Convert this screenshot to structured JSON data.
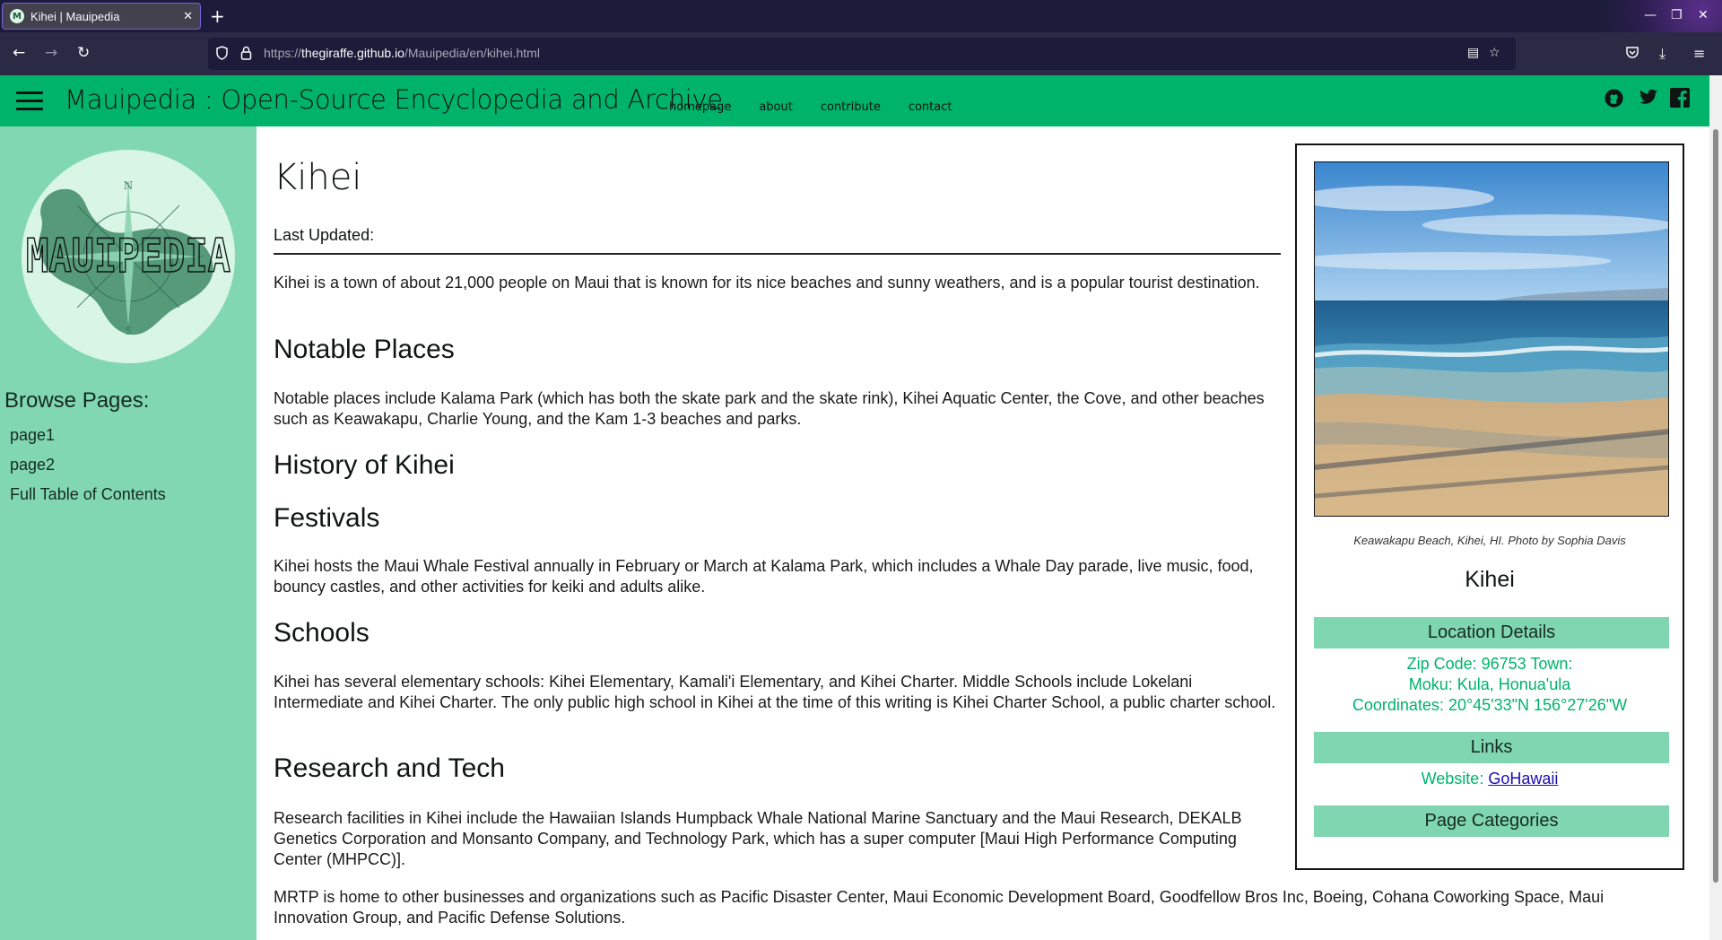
{
  "browser": {
    "tab_title": "Kihei | Mauipedia",
    "favicon_letter": "M",
    "url_prefix": "https://",
    "url_host": "thegiraffe.github.io",
    "url_path": "/Mauipedia/en/kihei.html"
  },
  "header": {
    "title": "Mauipedia : Open-Source Encyclopedia and Archive",
    "nav": [
      "homepage",
      "about",
      "contribute",
      "contact"
    ]
  },
  "sidebar": {
    "logo_text": "MAUIPEDIA",
    "compass_n": "N",
    "compass_s": "S",
    "browse_title": "Browse Pages:",
    "links": [
      "page1",
      "page2",
      "Full Table of Contents"
    ]
  },
  "article": {
    "title": "Kihei",
    "last_updated": "Last Updated:",
    "intro": "Kihei is a town of about 21,000 people on Maui that is known for its nice beaches and sunny weathers, and is a popular tourist destination.",
    "sections": [
      {
        "heading": "Notable Places",
        "text": "Notable places include Kalama Park (which has both the skate park and the skate rink), Kihei Aquatic Center, the Cove, and other beaches such as Keawakapu, Charlie Young, and the Kam 1-3 beaches and parks."
      },
      {
        "heading": "History of Kihei",
        "text": ""
      },
      {
        "heading": "Festivals",
        "text": "Kihei hosts the Maui Whale Festival annually in February or March at Kalama Park, which includes a Whale Day parade, live music, food, bouncy castles, and other activities for keiki and adults alike."
      },
      {
        "heading": "Schools",
        "text": "Kihei has several elementary schools: Kihei Elementary, Kamali'i Elementary, and Kihei Charter. Middle Schools include Lokelani Intermediate and Kihei Charter. The only public high school in Kihei at the time of this writing is Kihei Charter School, a public charter school."
      },
      {
        "heading": "Research and Tech",
        "text": "Research facilities in Kihei include the Hawaiian Islands Humpback Whale National Marine Sanctuary and the Maui Research, DEKALB Genetics Corporation and Monsanto Company, and Technology Park, which has a super computer [Maui High Performance Computing Center (MHPCC)]."
      }
    ],
    "extra_paragraph": "MRTP is home to other businesses and organizations such as Pacific Disaster Center, Maui Economic Development Board, Goodfellow Bros Inc, Boeing, Cohana Coworking Space, Maui Innovation Group, and Pacific Defense Solutions."
  },
  "infobox": {
    "caption": "Keawakapu Beach, Kihei, HI. Photo by Sophia Davis",
    "name": "Kihei",
    "location_heading": "Location Details",
    "zip_line": "Zip Code: 96753 Town:",
    "moku_line": "Moku: Kula, Honua'ula",
    "coords_line": "Coordinates: 20°45'33\"N 156°27'26\"W",
    "links_heading": "Links",
    "website_label": "Website:",
    "website_link": "GoHawaii",
    "categories_heading": "Page Categories"
  },
  "colors": {
    "brand_green": "#00b36b",
    "sidebar_green": "#82d7b3",
    "infobox_header": "#7fd6b1"
  }
}
